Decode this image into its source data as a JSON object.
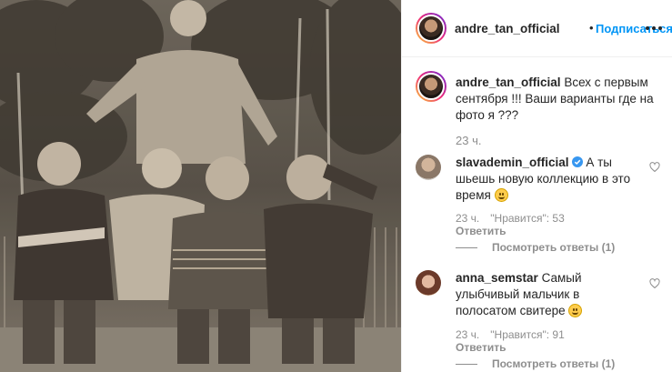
{
  "post": {
    "author": "andre_tan_official",
    "follow_label": "Подписаться",
    "separator": "•"
  },
  "caption": {
    "username": "andre_tan_official",
    "text": "Всех с первым сентября !!! Ваши варианты где на фото я ???",
    "time": "23 ч."
  },
  "comments": [
    {
      "username": "slavademin_official",
      "verified": true,
      "text": "А ты шьешь новую коллекцию в это время",
      "time": "23 ч.",
      "likes": "\"Нравится\": 53",
      "reply": "Ответить",
      "view_replies": "Посмотреть ответы (1)"
    },
    {
      "username": "anna_semstar",
      "verified": false,
      "text": "Самый улыбчивый мальчик в полосатом свитере",
      "time": "23 ч.",
      "likes": "\"Нравится\": 91",
      "reply": "Ответить",
      "view_replies": "Посмотреть ответы (1)"
    }
  ],
  "icons": {
    "more": "more-horizontal-icon",
    "like": "heart-outline-icon",
    "verified": "verified-badge-icon",
    "emoji": "smiling-face-emoji"
  },
  "colors": {
    "link_blue": "#0095f6",
    "text": "#262626",
    "muted": "#8e8e8e",
    "verified": "#3897f0",
    "border": "#efefef"
  }
}
